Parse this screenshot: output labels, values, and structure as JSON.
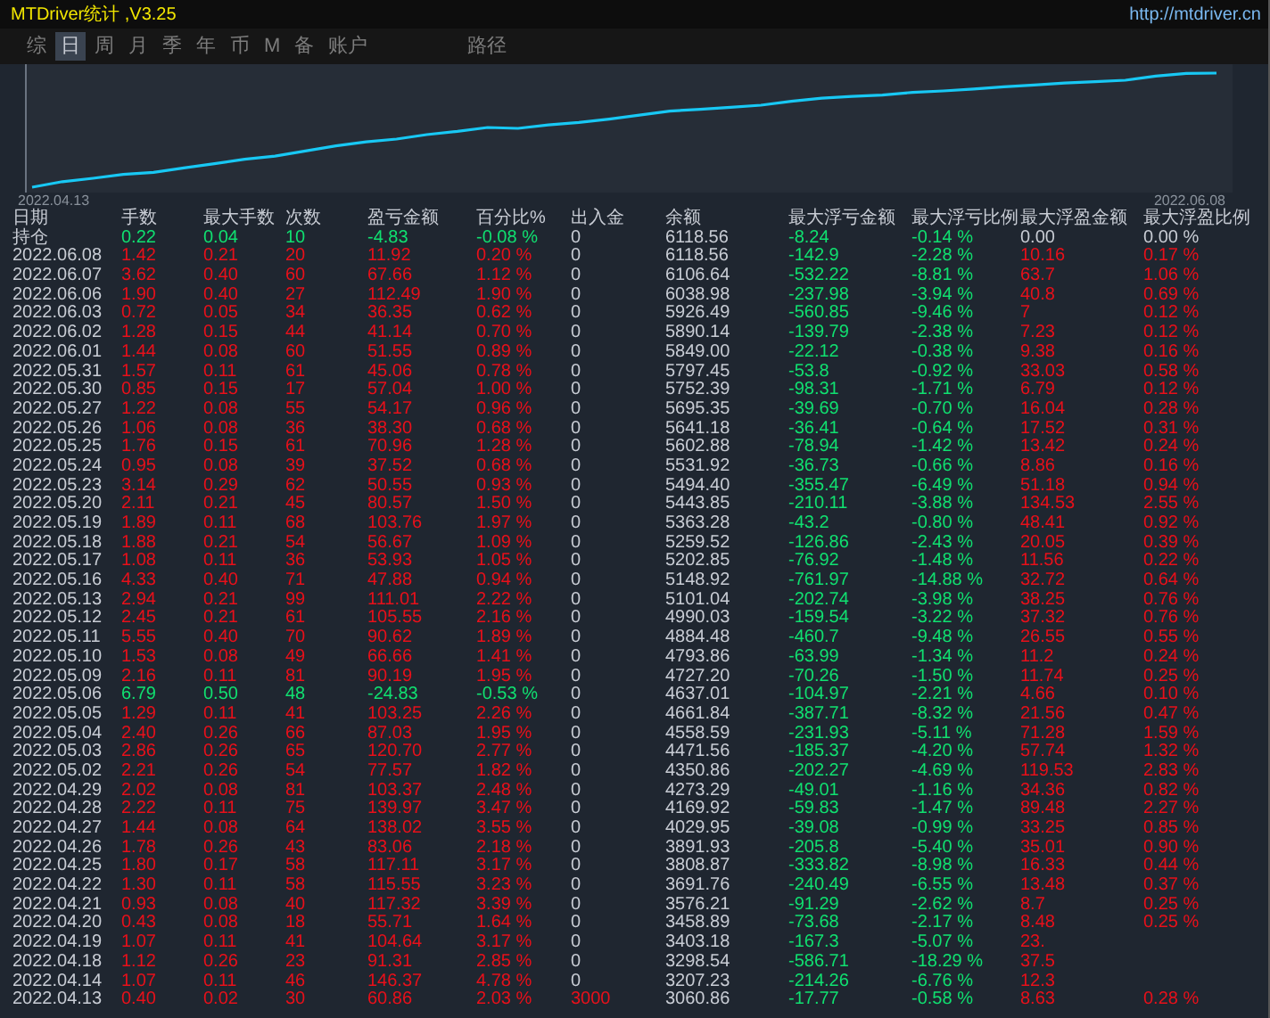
{
  "window": {
    "title": "MTDriver统计 ,V3.25",
    "link": "http://mtdriver.cn"
  },
  "tabs": [
    {
      "label": "综",
      "selected": false
    },
    {
      "label": "日",
      "selected": true
    },
    {
      "label": "周",
      "selected": false
    },
    {
      "label": "月",
      "selected": false
    },
    {
      "label": "季",
      "selected": false
    },
    {
      "label": "年",
      "selected": false
    },
    {
      "label": "币",
      "selected": false
    },
    {
      "label": "M",
      "selected": false
    },
    {
      "label": "备",
      "selected": false
    },
    {
      "label": "账户",
      "selected": false
    },
    {
      "label": "路径",
      "selected": false
    }
  ],
  "chart": {
    "start_label": "2022.04.13",
    "end_label": "2022.06.08"
  },
  "table": {
    "columns": [
      "日期",
      "手数",
      "最大手数",
      "次数",
      "盈亏金额",
      "百分比%",
      "出入金",
      "余额",
      "最大浮亏金额",
      "最大浮亏比例",
      "最大浮盈金额",
      "最大浮盈比例"
    ],
    "rows": [
      {
        "kind": "holding",
        "loss": true,
        "deposit": false,
        "date": "持仓",
        "lots": "0.22",
        "max_lots": "0.04",
        "trades": "10",
        "profit": "-4.83",
        "profit_pct": "-0.08 %",
        "flow": "0",
        "balance": "6118.56",
        "max_float_loss": "-8.24",
        "max_float_loss_pct": "-0.14 %",
        "max_float_profit": "0.00",
        "max_float_profit_pct": "0.00 %"
      },
      {
        "kind": "day",
        "loss": false,
        "deposit": false,
        "date": "2022.06.08",
        "lots": "1.42",
        "max_lots": "0.21",
        "trades": "20",
        "profit": "11.92",
        "profit_pct": "0.20 %",
        "flow": "0",
        "balance": "6118.56",
        "max_float_loss": "-142.9",
        "max_float_loss_pct": "-2.28 %",
        "max_float_profit": "10.16",
        "max_float_profit_pct": "0.17 %"
      },
      {
        "kind": "day",
        "loss": false,
        "deposit": false,
        "date": "2022.06.07",
        "lots": "3.62",
        "max_lots": "0.40",
        "trades": "60",
        "profit": "67.66",
        "profit_pct": "1.12 %",
        "flow": "0",
        "balance": "6106.64",
        "max_float_loss": "-532.22",
        "max_float_loss_pct": "-8.81 %",
        "max_float_profit": "63.7",
        "max_float_profit_pct": "1.06 %"
      },
      {
        "kind": "day",
        "loss": false,
        "deposit": false,
        "date": "2022.06.06",
        "lots": "1.90",
        "max_lots": "0.40",
        "trades": "27",
        "profit": "112.49",
        "profit_pct": "1.90 %",
        "flow": "0",
        "balance": "6038.98",
        "max_float_loss": "-237.98",
        "max_float_loss_pct": "-3.94 %",
        "max_float_profit": "40.8",
        "max_float_profit_pct": "0.69 %"
      },
      {
        "kind": "day",
        "loss": false,
        "deposit": false,
        "date": "2022.06.03",
        "lots": "0.72",
        "max_lots": "0.05",
        "trades": "34",
        "profit": "36.35",
        "profit_pct": "0.62 %",
        "flow": "0",
        "balance": "5926.49",
        "max_float_loss": "-560.85",
        "max_float_loss_pct": "-9.46 %",
        "max_float_profit": "7",
        "max_float_profit_pct": "0.12 %"
      },
      {
        "kind": "day",
        "loss": false,
        "deposit": false,
        "date": "2022.06.02",
        "lots": "1.28",
        "max_lots": "0.15",
        "trades": "44",
        "profit": "41.14",
        "profit_pct": "0.70 %",
        "flow": "0",
        "balance": "5890.14",
        "max_float_loss": "-139.79",
        "max_float_loss_pct": "-2.38 %",
        "max_float_profit": "7.23",
        "max_float_profit_pct": "0.12 %"
      },
      {
        "kind": "day",
        "loss": false,
        "deposit": false,
        "date": "2022.06.01",
        "lots": "1.44",
        "max_lots": "0.08",
        "trades": "60",
        "profit": "51.55",
        "profit_pct": "0.89 %",
        "flow": "0",
        "balance": "5849.00",
        "max_float_loss": "-22.12",
        "max_float_loss_pct": "-0.38 %",
        "max_float_profit": "9.38",
        "max_float_profit_pct": "0.16 %"
      },
      {
        "kind": "day",
        "loss": false,
        "deposit": false,
        "date": "2022.05.31",
        "lots": "1.57",
        "max_lots": "0.11",
        "trades": "61",
        "profit": "45.06",
        "profit_pct": "0.78 %",
        "flow": "0",
        "balance": "5797.45",
        "max_float_loss": "-53.8",
        "max_float_loss_pct": "-0.92 %",
        "max_float_profit": "33.03",
        "max_float_profit_pct": "0.58 %"
      },
      {
        "kind": "day",
        "loss": false,
        "deposit": false,
        "date": "2022.05.30",
        "lots": "0.85",
        "max_lots": "0.15",
        "trades": "17",
        "profit": "57.04",
        "profit_pct": "1.00 %",
        "flow": "0",
        "balance": "5752.39",
        "max_float_loss": "-98.31",
        "max_float_loss_pct": "-1.71 %",
        "max_float_profit": "6.79",
        "max_float_profit_pct": "0.12 %"
      },
      {
        "kind": "day",
        "loss": false,
        "deposit": false,
        "date": "2022.05.27",
        "lots": "1.22",
        "max_lots": "0.08",
        "trades": "55",
        "profit": "54.17",
        "profit_pct": "0.96 %",
        "flow": "0",
        "balance": "5695.35",
        "max_float_loss": "-39.69",
        "max_float_loss_pct": "-0.70 %",
        "max_float_profit": "16.04",
        "max_float_profit_pct": "0.28 %"
      },
      {
        "kind": "day",
        "loss": false,
        "deposit": false,
        "date": "2022.05.26",
        "lots": "1.06",
        "max_lots": "0.08",
        "trades": "36",
        "profit": "38.30",
        "profit_pct": "0.68 %",
        "flow": "0",
        "balance": "5641.18",
        "max_float_loss": "-36.41",
        "max_float_loss_pct": "-0.64 %",
        "max_float_profit": "17.52",
        "max_float_profit_pct": "0.31 %"
      },
      {
        "kind": "day",
        "loss": false,
        "deposit": false,
        "date": "2022.05.25",
        "lots": "1.76",
        "max_lots": "0.15",
        "trades": "61",
        "profit": "70.96",
        "profit_pct": "1.28 %",
        "flow": "0",
        "balance": "5602.88",
        "max_float_loss": "-78.94",
        "max_float_loss_pct": "-1.42 %",
        "max_float_profit": "13.42",
        "max_float_profit_pct": "0.24 %"
      },
      {
        "kind": "day",
        "loss": false,
        "deposit": false,
        "date": "2022.05.24",
        "lots": "0.95",
        "max_lots": "0.08",
        "trades": "39",
        "profit": "37.52",
        "profit_pct": "0.68 %",
        "flow": "0",
        "balance": "5531.92",
        "max_float_loss": "-36.73",
        "max_float_loss_pct": "-0.66 %",
        "max_float_profit": "8.86",
        "max_float_profit_pct": "0.16 %"
      },
      {
        "kind": "day",
        "loss": false,
        "deposit": false,
        "date": "2022.05.23",
        "lots": "3.14",
        "max_lots": "0.29",
        "trades": "62",
        "profit": "50.55",
        "profit_pct": "0.93 %",
        "flow": "0",
        "balance": "5494.40",
        "max_float_loss": "-355.47",
        "max_float_loss_pct": "-6.49 %",
        "max_float_profit": "51.18",
        "max_float_profit_pct": "0.94 %"
      },
      {
        "kind": "day",
        "loss": false,
        "deposit": false,
        "date": "2022.05.20",
        "lots": "2.11",
        "max_lots": "0.21",
        "trades": "45",
        "profit": "80.57",
        "profit_pct": "1.50 %",
        "flow": "0",
        "balance": "5443.85",
        "max_float_loss": "-210.11",
        "max_float_loss_pct": "-3.88 %",
        "max_float_profit": "134.53",
        "max_float_profit_pct": "2.55 %"
      },
      {
        "kind": "day",
        "loss": false,
        "deposit": false,
        "date": "2022.05.19",
        "lots": "1.89",
        "max_lots": "0.11",
        "trades": "68",
        "profit": "103.76",
        "profit_pct": "1.97 %",
        "flow": "0",
        "balance": "5363.28",
        "max_float_loss": "-43.2",
        "max_float_loss_pct": "-0.80 %",
        "max_float_profit": "48.41",
        "max_float_profit_pct": "0.92 %"
      },
      {
        "kind": "day",
        "loss": false,
        "deposit": false,
        "date": "2022.05.18",
        "lots": "1.88",
        "max_lots": "0.21",
        "trades": "54",
        "profit": "56.67",
        "profit_pct": "1.09 %",
        "flow": "0",
        "balance": "5259.52",
        "max_float_loss": "-126.86",
        "max_float_loss_pct": "-2.43 %",
        "max_float_profit": "20.05",
        "max_float_profit_pct": "0.39 %"
      },
      {
        "kind": "day",
        "loss": false,
        "deposit": false,
        "date": "2022.05.17",
        "lots": "1.08",
        "max_lots": "0.11",
        "trades": "36",
        "profit": "53.93",
        "profit_pct": "1.05 %",
        "flow": "0",
        "balance": "5202.85",
        "max_float_loss": "-76.92",
        "max_float_loss_pct": "-1.48 %",
        "max_float_profit": "11.56",
        "max_float_profit_pct": "0.22 %"
      },
      {
        "kind": "day",
        "loss": false,
        "deposit": false,
        "date": "2022.05.16",
        "lots": "4.33",
        "max_lots": "0.40",
        "trades": "71",
        "profit": "47.88",
        "profit_pct": "0.94 %",
        "flow": "0",
        "balance": "5148.92",
        "max_float_loss": "-761.97",
        "max_float_loss_pct": "-14.88 %",
        "max_float_profit": "32.72",
        "max_float_profit_pct": "0.64 %"
      },
      {
        "kind": "day",
        "loss": false,
        "deposit": false,
        "date": "2022.05.13",
        "lots": "2.94",
        "max_lots": "0.21",
        "trades": "99",
        "profit": "111.01",
        "profit_pct": "2.22 %",
        "flow": "0",
        "balance": "5101.04",
        "max_float_loss": "-202.74",
        "max_float_loss_pct": "-3.98 %",
        "max_float_profit": "38.25",
        "max_float_profit_pct": "0.76 %"
      },
      {
        "kind": "day",
        "loss": false,
        "deposit": false,
        "date": "2022.05.12",
        "lots": "2.45",
        "max_lots": "0.21",
        "trades": "61",
        "profit": "105.55",
        "profit_pct": "2.16 %",
        "flow": "0",
        "balance": "4990.03",
        "max_float_loss": "-159.54",
        "max_float_loss_pct": "-3.22 %",
        "max_float_profit": "37.32",
        "max_float_profit_pct": "0.76 %"
      },
      {
        "kind": "day",
        "loss": false,
        "deposit": false,
        "date": "2022.05.11",
        "lots": "5.55",
        "max_lots": "0.40",
        "trades": "70",
        "profit": "90.62",
        "profit_pct": "1.89 %",
        "flow": "0",
        "balance": "4884.48",
        "max_float_loss": "-460.7",
        "max_float_loss_pct": "-9.48 %",
        "max_float_profit": "26.55",
        "max_float_profit_pct": "0.55 %"
      },
      {
        "kind": "day",
        "loss": false,
        "deposit": false,
        "date": "2022.05.10",
        "lots": "1.53",
        "max_lots": "0.08",
        "trades": "49",
        "profit": "66.66",
        "profit_pct": "1.41 %",
        "flow": "0",
        "balance": "4793.86",
        "max_float_loss": "-63.99",
        "max_float_loss_pct": "-1.34 %",
        "max_float_profit": "11.2",
        "max_float_profit_pct": "0.24 %"
      },
      {
        "kind": "day",
        "loss": false,
        "deposit": false,
        "date": "2022.05.09",
        "lots": "2.16",
        "max_lots": "0.11",
        "trades": "81",
        "profit": "90.19",
        "profit_pct": "1.95 %",
        "flow": "0",
        "balance": "4727.20",
        "max_float_loss": "-70.26",
        "max_float_loss_pct": "-1.50 %",
        "max_float_profit": "11.74",
        "max_float_profit_pct": "0.25 %"
      },
      {
        "kind": "day",
        "loss": true,
        "deposit": false,
        "date": "2022.05.06",
        "lots": "6.79",
        "max_lots": "0.50",
        "trades": "48",
        "profit": "-24.83",
        "profit_pct": "-0.53 %",
        "flow": "0",
        "balance": "4637.01",
        "max_float_loss": "-104.97",
        "max_float_loss_pct": "-2.21 %",
        "max_float_profit": "4.66",
        "max_float_profit_pct": "0.10 %"
      },
      {
        "kind": "day",
        "loss": false,
        "deposit": false,
        "date": "2022.05.05",
        "lots": "1.29",
        "max_lots": "0.11",
        "trades": "41",
        "profit": "103.25",
        "profit_pct": "2.26 %",
        "flow": "0",
        "balance": "4661.84",
        "max_float_loss": "-387.71",
        "max_float_loss_pct": "-8.32 %",
        "max_float_profit": "21.56",
        "max_float_profit_pct": "0.47 %"
      },
      {
        "kind": "day",
        "loss": false,
        "deposit": false,
        "date": "2022.05.04",
        "lots": "2.40",
        "max_lots": "0.26",
        "trades": "66",
        "profit": "87.03",
        "profit_pct": "1.95 %",
        "flow": "0",
        "balance": "4558.59",
        "max_float_loss": "-231.93",
        "max_float_loss_pct": "-5.11 %",
        "max_float_profit": "71.28",
        "max_float_profit_pct": "1.59 %"
      },
      {
        "kind": "day",
        "loss": false,
        "deposit": false,
        "date": "2022.05.03",
        "lots": "2.86",
        "max_lots": "0.26",
        "trades": "65",
        "profit": "120.70",
        "profit_pct": "2.77 %",
        "flow": "0",
        "balance": "4471.56",
        "max_float_loss": "-185.37",
        "max_float_loss_pct": "-4.20 %",
        "max_float_profit": "57.74",
        "max_float_profit_pct": "1.32 %"
      },
      {
        "kind": "day",
        "loss": false,
        "deposit": false,
        "date": "2022.05.02",
        "lots": "2.21",
        "max_lots": "0.26",
        "trades": "54",
        "profit": "77.57",
        "profit_pct": "1.82 %",
        "flow": "0",
        "balance": "4350.86",
        "max_float_loss": "-202.27",
        "max_float_loss_pct": "-4.69 %",
        "max_float_profit": "119.53",
        "max_float_profit_pct": "2.83 %"
      },
      {
        "kind": "day",
        "loss": false,
        "deposit": false,
        "date": "2022.04.29",
        "lots": "2.02",
        "max_lots": "0.08",
        "trades": "81",
        "profit": "103.37",
        "profit_pct": "2.48 %",
        "flow": "0",
        "balance": "4273.29",
        "max_float_loss": "-49.01",
        "max_float_loss_pct": "-1.16 %",
        "max_float_profit": "34.36",
        "max_float_profit_pct": "0.82 %"
      },
      {
        "kind": "day",
        "loss": false,
        "deposit": false,
        "date": "2022.04.28",
        "lots": "2.22",
        "max_lots": "0.11",
        "trades": "75",
        "profit": "139.97",
        "profit_pct": "3.47 %",
        "flow": "0",
        "balance": "4169.92",
        "max_float_loss": "-59.83",
        "max_float_loss_pct": "-1.47 %",
        "max_float_profit": "89.48",
        "max_float_profit_pct": "2.27 %"
      },
      {
        "kind": "day",
        "loss": false,
        "deposit": false,
        "date": "2022.04.27",
        "lots": "1.44",
        "max_lots": "0.08",
        "trades": "64",
        "profit": "138.02",
        "profit_pct": "3.55 %",
        "flow": "0",
        "balance": "4029.95",
        "max_float_loss": "-39.08",
        "max_float_loss_pct": "-0.99 %",
        "max_float_profit": "33.25",
        "max_float_profit_pct": "0.85 %"
      },
      {
        "kind": "day",
        "loss": false,
        "deposit": false,
        "date": "2022.04.26",
        "lots": "1.78",
        "max_lots": "0.26",
        "trades": "43",
        "profit": "83.06",
        "profit_pct": "2.18 %",
        "flow": "0",
        "balance": "3891.93",
        "max_float_loss": "-205.8",
        "max_float_loss_pct": "-5.40 %",
        "max_float_profit": "35.01",
        "max_float_profit_pct": "0.90 %"
      },
      {
        "kind": "day",
        "loss": false,
        "deposit": false,
        "date": "2022.04.25",
        "lots": "1.80",
        "max_lots": "0.17",
        "trades": "58",
        "profit": "117.11",
        "profit_pct": "3.17 %",
        "flow": "0",
        "balance": "3808.87",
        "max_float_loss": "-333.82",
        "max_float_loss_pct": "-8.98 %",
        "max_float_profit": "16.33",
        "max_float_profit_pct": "0.44 %"
      },
      {
        "kind": "day",
        "loss": false,
        "deposit": false,
        "date": "2022.04.22",
        "lots": "1.30",
        "max_lots": "0.11",
        "trades": "58",
        "profit": "115.55",
        "profit_pct": "3.23 %",
        "flow": "0",
        "balance": "3691.76",
        "max_float_loss": "-240.49",
        "max_float_loss_pct": "-6.55 %",
        "max_float_profit": "13.48",
        "max_float_profit_pct": "0.37 %"
      },
      {
        "kind": "day",
        "loss": false,
        "deposit": false,
        "date": "2022.04.21",
        "lots": "0.93",
        "max_lots": "0.08",
        "trades": "40",
        "profit": "117.32",
        "profit_pct": "3.39 %",
        "flow": "0",
        "balance": "3576.21",
        "max_float_loss": "-91.29",
        "max_float_loss_pct": "-2.62 %",
        "max_float_profit": "8.7",
        "max_float_profit_pct": "0.25 %"
      },
      {
        "kind": "day",
        "loss": false,
        "deposit": false,
        "date": "2022.04.20",
        "lots": "0.43",
        "max_lots": "0.08",
        "trades": "18",
        "profit": "55.71",
        "profit_pct": "1.64 %",
        "flow": "0",
        "balance": "3458.89",
        "max_float_loss": "-73.68",
        "max_float_loss_pct": "-2.17 %",
        "max_float_profit": "8.48",
        "max_float_profit_pct": "0.25 %"
      },
      {
        "kind": "day",
        "loss": false,
        "deposit": false,
        "date": "2022.04.19",
        "lots": "1.07",
        "max_lots": "0.11",
        "trades": "41",
        "profit": "104.64",
        "profit_pct": "3.17 %",
        "flow": "0",
        "balance": "3403.18",
        "max_float_loss": "-167.3",
        "max_float_loss_pct": "-5.07 %",
        "max_float_profit": "23."
      },
      {
        "kind": "day",
        "loss": false,
        "deposit": false,
        "date": "2022.04.18",
        "lots": "1.12",
        "max_lots": "0.26",
        "trades": "23",
        "profit": "91.31",
        "profit_pct": "2.85 %",
        "flow": "0",
        "balance": "3298.54",
        "max_float_loss": "-586.71",
        "max_float_loss_pct": "-18.29 %",
        "max_float_profit": "37.5"
      },
      {
        "kind": "day",
        "loss": false,
        "deposit": false,
        "date": "2022.04.14",
        "lots": "1.07",
        "max_lots": "0.11",
        "trades": "46",
        "profit": "146.37",
        "profit_pct": "4.78 %",
        "flow": "0",
        "balance": "3207.23",
        "max_float_loss": "-214.26",
        "max_float_loss_pct": "-6.76 %",
        "max_float_profit": "12.3"
      },
      {
        "kind": "day",
        "loss": false,
        "deposit": true,
        "date": "2022.04.13",
        "lots": "0.40",
        "max_lots": "0.02",
        "trades": "30",
        "profit": "60.86",
        "profit_pct": "2.03 %",
        "flow": "3000",
        "balance": "3060.86",
        "max_float_loss": "-17.77",
        "max_float_loss_pct": "-0.58 %",
        "max_float_profit": "8.63",
        "max_float_profit_pct": "0.28 %"
      }
    ]
  }
}
